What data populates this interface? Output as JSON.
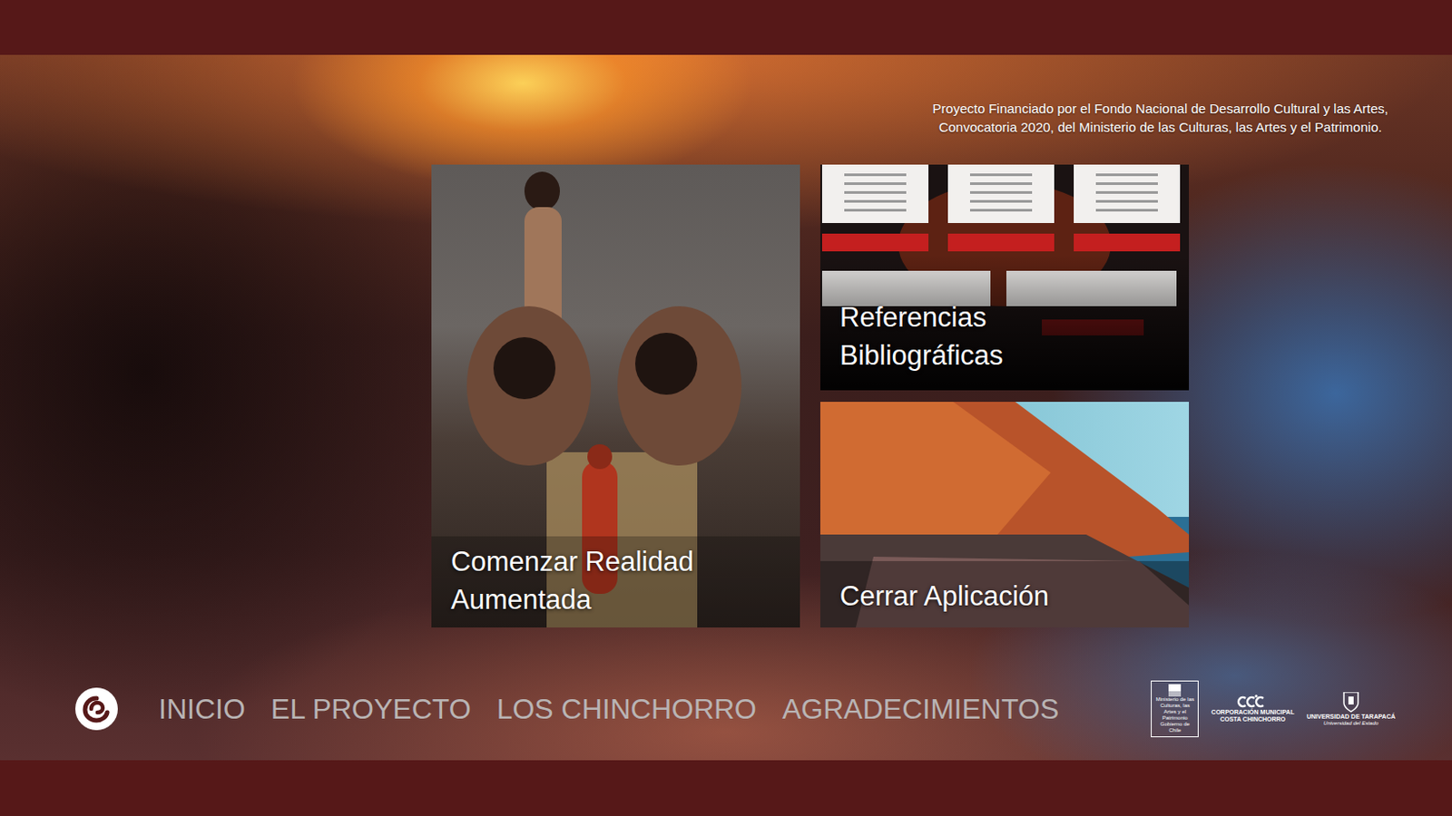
{
  "funding": {
    "lines": [
      "Proyecto Financiado por el Fondo Nacional de Desarrollo Cultural y las Artes,",
      "Convocatoria 2020, del Ministerio de las Culturas, las Artes y el Patrimonio."
    ]
  },
  "cards": [
    {
      "label": "Comenzar Realidad Aumentada",
      "kind": "ar"
    },
    {
      "label": "Referencias Bibliográficas",
      "kind": "refs"
    },
    {
      "label": "Cerrar Aplicación",
      "kind": "close"
    }
  ],
  "nav": [
    {
      "label": "INICIO"
    },
    {
      "label": "EL PROYECTO"
    },
    {
      "label": "LOS CHINCHORRO"
    },
    {
      "label": "AGRADECIMIENTOS"
    }
  ],
  "sponsors": [
    {
      "kind": "ministerio",
      "lines": [
        "Ministerio de las Culturas, las Artes y el Patrimonio",
        "Gobierno de Chile"
      ]
    },
    {
      "kind": "ccc",
      "lines": [
        "CORPORACIÓN MUNICIPAL",
        "COSTA CHINCHORRO"
      ]
    },
    {
      "kind": "uta",
      "lines": [
        "UNIVERSIDAD DE TARAPACÁ",
        "Universidad del Estado"
      ]
    }
  ]
}
